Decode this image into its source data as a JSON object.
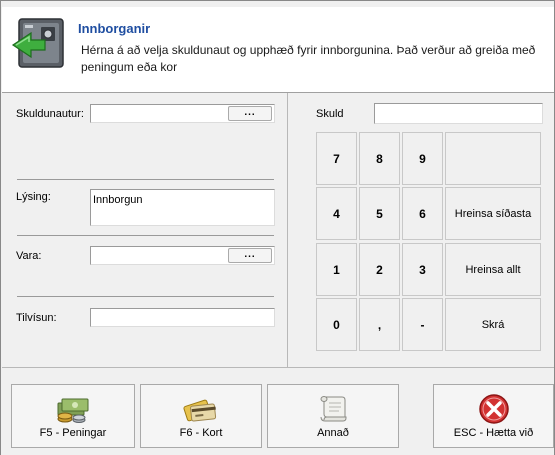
{
  "header": {
    "title": "Innborganir",
    "description": "Hérna á að velja skuldunaut og upphæð fyrir innborgunina.  Það verður að greiða með peningum eða kor"
  },
  "form": {
    "skuldunautur_label": "Skuldunautur:",
    "skuldunautur_value": "",
    "ellipsis": "...",
    "lysing_label": "Lýsing:",
    "lysing_value": "Innborgun",
    "vara_label": "Vara:",
    "vara_value": "",
    "tilvisun_label": "Tilvísun:",
    "tilvisun_value": ""
  },
  "keypad": {
    "skuld_label": "Skuld",
    "skuld_value": "",
    "keys": [
      "7",
      "8",
      "9",
      "4",
      "5",
      "6",
      "1",
      "2",
      "3",
      "0",
      ",",
      "-"
    ],
    "hreinsa_sidasta": "Hreinsa síðasta",
    "hreinsa_allt": "Hreinsa allt",
    "skra": "Skrá"
  },
  "footer": {
    "peningar": "F5 - Peningar",
    "kort": "F6 - Kort",
    "annad": "Annað",
    "haetta": "ESC - Hætta við"
  }
}
